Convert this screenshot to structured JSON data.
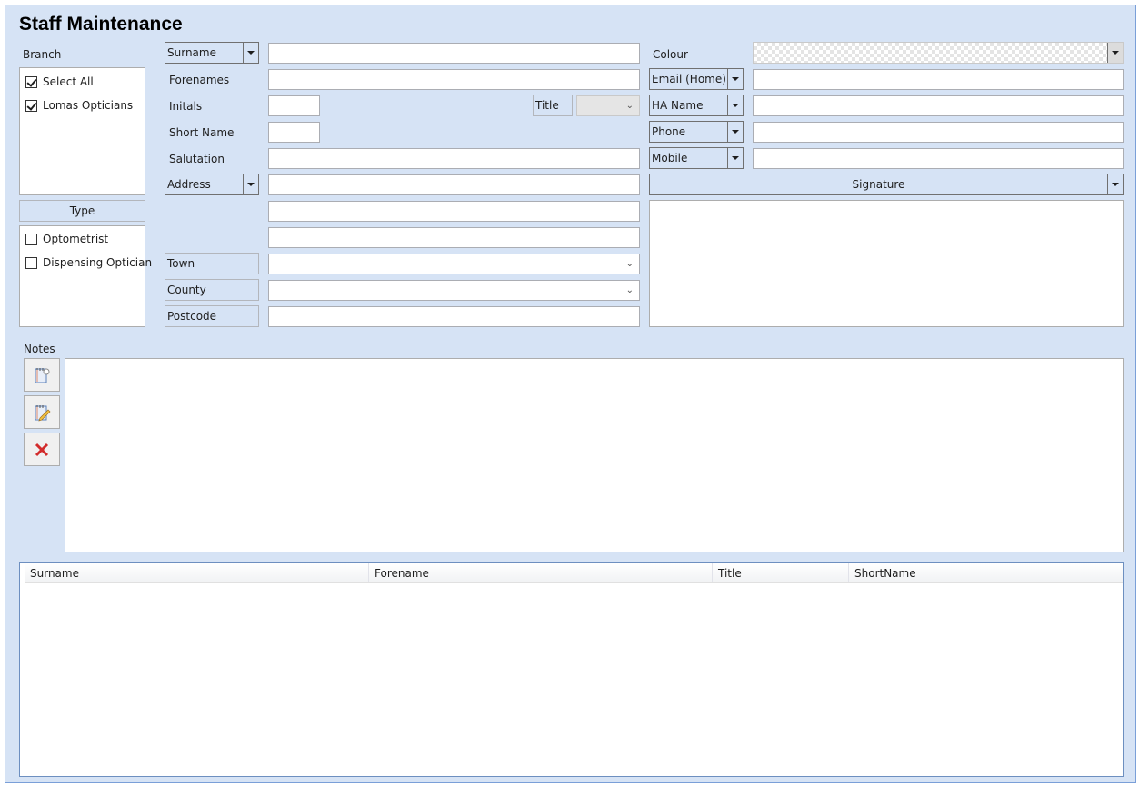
{
  "title": "Staff Maintenance",
  "branch": {
    "label": "Branch",
    "items": [
      {
        "label": "Select All",
        "checked": true
      },
      {
        "label": "Lomas Opticians",
        "checked": true
      }
    ]
  },
  "type": {
    "header": "Type",
    "items": [
      {
        "label": "Optometrist",
        "checked": false
      },
      {
        "label": "Dispensing Optician",
        "checked": false
      }
    ]
  },
  "form": {
    "name_selector": "Surname",
    "surname_value": "",
    "forenames_label": "Forenames",
    "forenames_value": "",
    "initials_label": "Initals",
    "initials_value": "",
    "title_label": "Title",
    "title_value": "",
    "short_name_label": "Short Name",
    "short_name_value": "",
    "salutation_label": "Salutation",
    "salutation_value": "",
    "address_selector": "Address",
    "address_line1": "",
    "address_line2": "",
    "address_line3": "",
    "town_label": "Town",
    "town_value": "",
    "county_label": "County",
    "county_value": "",
    "postcode_label": "Postcode",
    "postcode_value": ""
  },
  "contact": {
    "colour_label": "Colour",
    "email_selector": "Email (Home)",
    "email_value": "",
    "ha_selector": "HA Name",
    "ha_value": "",
    "phone_selector": "Phone",
    "phone_value": "",
    "mobile_selector": "Mobile",
    "mobile_value": "",
    "signature_selector": "Signature"
  },
  "notes": {
    "label": "Notes",
    "value": "",
    "buttons": [
      "new-note-icon",
      "edit-note-icon",
      "delete-note-icon"
    ]
  },
  "grid": {
    "columns": [
      "Surname",
      "Forename",
      "Title",
      "ShortName"
    ],
    "rows": []
  }
}
